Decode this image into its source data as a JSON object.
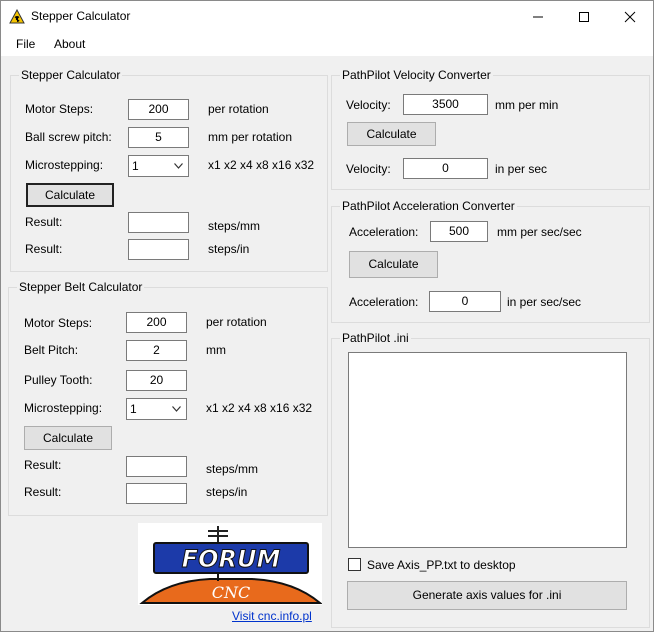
{
  "window": {
    "title": "Stepper Calculator"
  },
  "menu": {
    "file": "File",
    "about": "About"
  },
  "stepper": {
    "title": "Stepper Calculator",
    "motor_steps_label": "Motor Steps:",
    "motor_steps_value": "200",
    "motor_steps_unit": "per rotation",
    "pitch_label": "Ball screw pitch:",
    "pitch_value": "5",
    "pitch_unit": "mm per rotation",
    "micro_label": "Microstepping:",
    "micro_value": "1",
    "micro_hint": "x1 x2 x4 x8 x16 x32",
    "calculate": "Calculate",
    "result1_label": "Result:",
    "result1_value": "",
    "result1_unit": "steps/mm",
    "result2_label": "Result:",
    "result2_value": "",
    "result2_unit": "steps/in"
  },
  "belt": {
    "title": "Stepper Belt Calculator",
    "motor_steps_label": "Motor Steps:",
    "motor_steps_value": "200",
    "motor_steps_unit": "per rotation",
    "pitch_label": "Belt Pitch:",
    "pitch_value": "2",
    "pitch_unit": "mm",
    "tooth_label": "Pulley Tooth:",
    "tooth_value": "20",
    "micro_label": "Microstepping:",
    "micro_value": "1",
    "micro_hint": "x1 x2 x4 x8 x16 x32",
    "calculate": "Calculate",
    "result1_label": "Result:",
    "result1_value": "",
    "result1_unit": "steps/mm",
    "result2_label": "Result:",
    "result2_value": "",
    "result2_unit": "steps/in"
  },
  "velocity": {
    "title": "PathPilot Velocity Converter",
    "in_label": "Velocity:",
    "in_value": "3500",
    "in_unit": "mm per min",
    "calculate": "Calculate",
    "out_label": "Velocity:",
    "out_value": "0",
    "out_unit": "in per sec"
  },
  "accel": {
    "title": "PathPilot Acceleration Converter",
    "in_label": "Acceleration:",
    "in_value": "500",
    "in_unit": "mm per sec/sec",
    "calculate": "Calculate",
    "out_label": "Acceleration:",
    "out_value": "0",
    "out_unit": "in per sec/sec"
  },
  "ini": {
    "title": "PathPilot .ini",
    "save_label": "Save Axis_PP.txt to desktop",
    "generate": "Generate axis values for .ini"
  },
  "logo": {
    "forum": "FORUM",
    "cnc": "CNC"
  },
  "link": {
    "text": "Visit cnc.info.pl"
  }
}
